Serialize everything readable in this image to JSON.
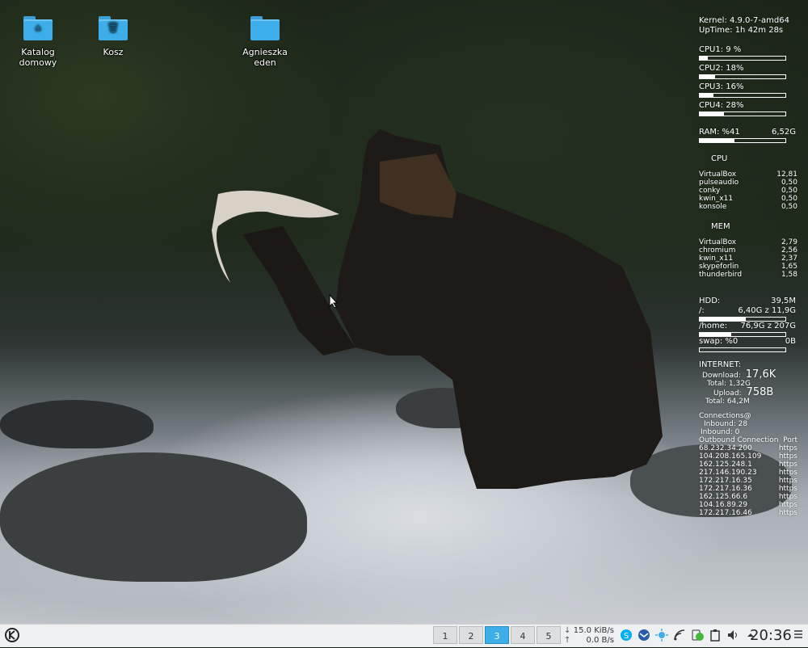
{
  "desktop": {
    "icons": [
      {
        "label": "Katalog domowy",
        "icon": "home-folder-icon"
      },
      {
        "label": "Kosz",
        "icon": "trash-folder-icon"
      },
      {
        "label": "Agnieszka eden",
        "icon": "folder-icon"
      }
    ],
    "wallpaper": "bear-catching-salmon-in-river"
  },
  "conky": {
    "kernel": "Kernel: 4.9.0-7-amd64",
    "uptime": "UpTime: 1h 42m 28s",
    "cpus": [
      {
        "label": "CPU1: 9 %",
        "usage": 0.09
      },
      {
        "label": "CPU2: 18%",
        "usage": 0.18
      },
      {
        "label": "CPU3: 16%",
        "usage": 0.16
      },
      {
        "label": "CPU4: 28%",
        "usage": 0.28
      }
    ],
    "ram": {
      "label": "RAM:  %41",
      "value": "6,52G",
      "usage": 0.41
    },
    "cpu_header": "CPU",
    "cpu_procs": [
      {
        "name": "VirtualBox",
        "value": "12,81"
      },
      {
        "name": "pulseaudio",
        "value": "0,50"
      },
      {
        "name": "conky",
        "value": "0,50"
      },
      {
        "name": "kwin_x11",
        "value": "0,50"
      },
      {
        "name": "konsole",
        "value": "0,50"
      }
    ],
    "mem_header": "MEM",
    "mem_procs": [
      {
        "name": "VirtualBox",
        "value": "2,79"
      },
      {
        "name": "chromium",
        "value": "2,56"
      },
      {
        "name": "kwin_x11",
        "value": "2,37"
      },
      {
        "name": "skypeforlin",
        "value": "1,65"
      },
      {
        "name": "thunderbird",
        "value": "1,58"
      }
    ],
    "hdd": {
      "label": "HDD:",
      "value": "39,5M"
    },
    "root": {
      "label": "/:",
      "value": "6,40G z 11,9G",
      "usage": 0.54
    },
    "home": {
      "label": "/home:",
      "value": "76,9G z 207G",
      "usage": 0.37
    },
    "swap": {
      "label": "swap: %0",
      "value": "0B",
      "usage": 0.0
    },
    "internet": {
      "title": "INTERNET:",
      "download_label": "Download:",
      "download_value": "17,6K",
      "download_total": "Total: 1,32G",
      "upload_label": "Upload:",
      "upload_value": "758B",
      "upload_total": "Total: 64,2M"
    },
    "connections": {
      "title": "Connections@",
      "inbound": "Inbound: 28",
      "inbound2": "Inbound: 0",
      "outbound_header": "Outbound Connection",
      "port_header": "Port",
      "rows": [
        {
          "ip": "68.232.34.200",
          "port": "https"
        },
        {
          "ip": "104.208.165.109",
          "port": "https"
        },
        {
          "ip": "162.125.248.1",
          "port": "https"
        },
        {
          "ip": "217.146.190.23",
          "port": "https"
        },
        {
          "ip": "172.217.16.35",
          "port": "https"
        },
        {
          "ip": "172.217.16.36",
          "port": "https"
        },
        {
          "ip": "162.125.66.6",
          "port": "https"
        },
        {
          "ip": "104.16.89.29",
          "port": "https"
        },
        {
          "ip": "172.217.16.46",
          "port": "https"
        }
      ]
    }
  },
  "taskbar": {
    "launcher_icon": "kde-logo-icon",
    "desktops": [
      "1",
      "2",
      "3",
      "4",
      "5"
    ],
    "active_desktop": "3",
    "net": {
      "down": "15.0 KiB/s",
      "up": "0.0 B/s"
    },
    "tray": [
      {
        "icon": "skype-icon",
        "color": "#00aff0"
      },
      {
        "icon": "thunderbird-icon",
        "color": "#2a5caa"
      },
      {
        "icon": "weather-sun-icon",
        "color": "#3daee9"
      },
      {
        "icon": "wifi-icon",
        "color": "#31363b"
      },
      {
        "icon": "kdeconnect-icon",
        "color": "#43b83a"
      },
      {
        "icon": "clipboard-icon",
        "color": "#31363b"
      },
      {
        "icon": "volume-icon",
        "color": "#31363b"
      },
      {
        "icon": "expand-tray-icon",
        "color": "#31363b"
      }
    ],
    "clock": "20:36",
    "menu_icon": "hamburger-menu-icon"
  }
}
